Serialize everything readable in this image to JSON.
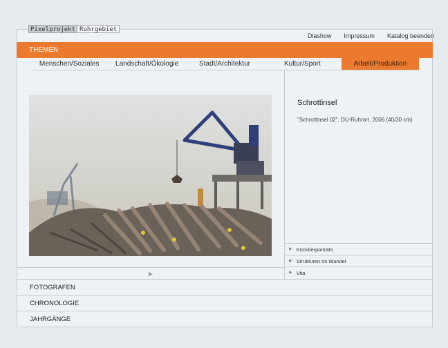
{
  "logo": {
    "part1": "Pixelprojekt",
    "part2": "Ruhrgebiet"
  },
  "topnav": {
    "slideshow": "Diashow",
    "imprint": "Impressum",
    "exit": "Katalog beenden"
  },
  "themen": {
    "label": "THEMEN"
  },
  "tabs": [
    {
      "label": "Menschen/Soziales"
    },
    {
      "label": "Landschaft/Ökologie"
    },
    {
      "label": "Stadt/Architektur"
    },
    {
      "label": "Kultur/Sport"
    },
    {
      "label": "Arbeit/Produktion"
    }
  ],
  "photo": {
    "title": "Schrottinsel",
    "caption": "\"Schrottinsel 02\", DU-Ruhrort, 2006 (40/30 cm)"
  },
  "sublinks": [
    {
      "label": "Künstlerporträts"
    },
    {
      "label": "Strukturen im Wandel"
    },
    {
      "label": "Vita"
    }
  ],
  "sections": [
    {
      "label": "FOTOGRAFEN"
    },
    {
      "label": "CHRONOLOGIE"
    },
    {
      "label": "JAHRGÄNGE"
    }
  ],
  "colors": {
    "accent": "#ec7a2e",
    "background": "#e6ebee"
  }
}
